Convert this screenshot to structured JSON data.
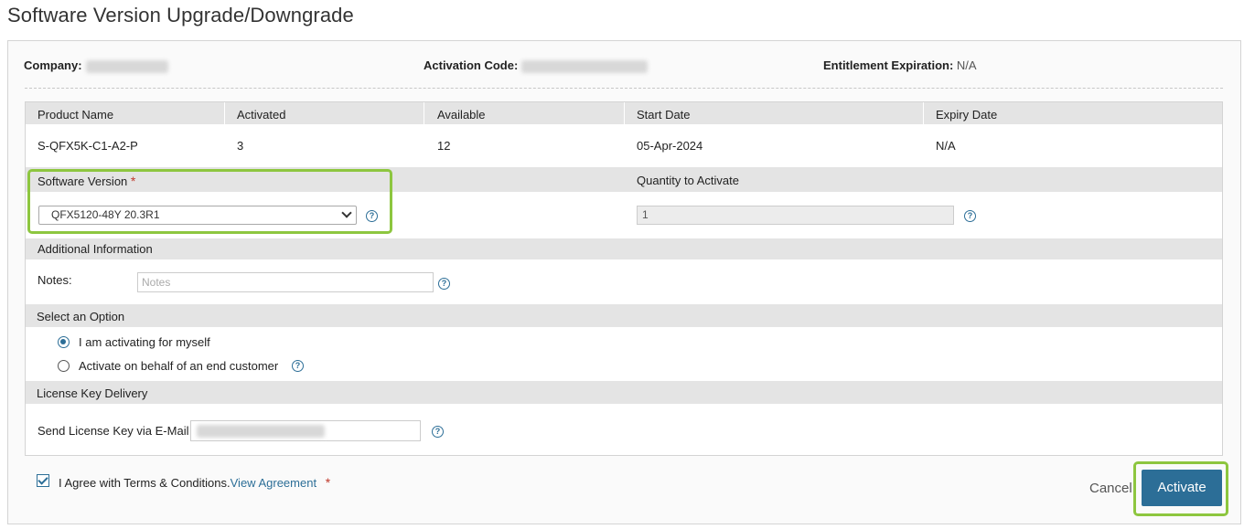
{
  "page": {
    "title": "Software Version Upgrade/Downgrade"
  },
  "info": {
    "company_label": "Company:",
    "activation_code_label": "Activation Code:",
    "entitlement_label": "Entitlement Expiration:",
    "entitlement_value": "N/A"
  },
  "product_table": {
    "headers": [
      "Product Name",
      "Activated",
      "Available",
      "Start Date",
      "Expiry Date"
    ],
    "row": [
      "S-QFX5K-C1-A2-P",
      "3",
      "12",
      "05-Apr-2024",
      "N/A"
    ]
  },
  "software_version": {
    "label": "Software Version",
    "required_mark": "*",
    "selected": "QFX5120-48Y 20.3R1"
  },
  "quantity": {
    "label": "Quantity to Activate",
    "value": "1"
  },
  "additional_info": {
    "header": "Additional Information",
    "notes_label": "Notes:",
    "notes_placeholder": "Notes"
  },
  "select_option": {
    "header": "Select an Option",
    "options": [
      {
        "label": "I am activating for myself",
        "checked": true
      },
      {
        "label": "Activate on behalf of an end customer",
        "checked": false
      }
    ]
  },
  "license_delivery": {
    "header": "License Key Delivery",
    "email_label": "Send License Key via E-Mail"
  },
  "agreement": {
    "text": "I Agree with Terms & Conditions.",
    "link": "View Agreement",
    "required_mark": "*",
    "checked": true
  },
  "buttons": {
    "cancel": "Cancel",
    "activate": "Activate"
  },
  "help_glyph": "?",
  "colors": {
    "accent": "#2c6e97",
    "highlight": "#8dc63f",
    "required": "#c0392b",
    "band": "#e4e4e4"
  }
}
